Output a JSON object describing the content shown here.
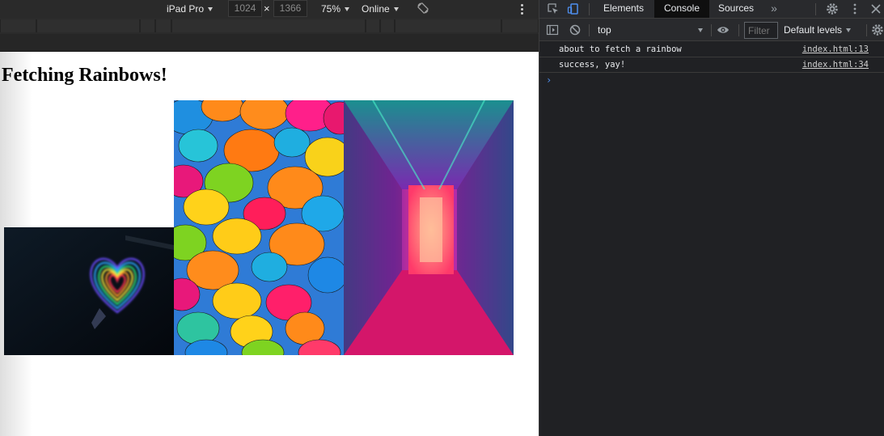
{
  "device_toolbar": {
    "device": "iPad Pro",
    "width": "1024",
    "times": "×",
    "height": "1366",
    "zoom": "75%",
    "network": "Online"
  },
  "page": {
    "heading": "Fetching Rainbows!",
    "images": [
      {
        "name": "neon-heart"
      },
      {
        "name": "colorful-umbrellas"
      },
      {
        "name": "neon-corridor"
      }
    ]
  },
  "devtools": {
    "tabs": [
      "Elements",
      "Console",
      "Sources"
    ],
    "active_tab": "Console",
    "more_tabs": "»",
    "console": {
      "context": "top",
      "filter_placeholder": "Filter",
      "levels": "Default levels",
      "messages": [
        {
          "text": "about to fetch a rainbow",
          "source": "index.html:13"
        },
        {
          "text": "success, yay!",
          "source": "index.html:34"
        }
      ],
      "prompt": "›"
    }
  },
  "colors": {
    "devtools_bg": "#202124",
    "accent": "#4e8ff0",
    "console_tab_bg": "#0f0f0f"
  }
}
